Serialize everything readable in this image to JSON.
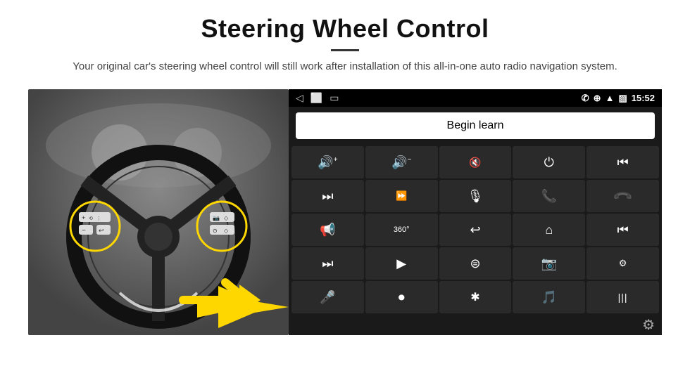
{
  "header": {
    "title": "Steering Wheel Control",
    "divider": true,
    "subtitle": "Your original car's steering wheel control will still work after installation of this all-in-one auto radio navigation system."
  },
  "status_bar": {
    "nav_back": "◁",
    "nav_home": "⬜",
    "nav_recent": "▭",
    "signal": "▨",
    "phone": "✆",
    "location": "⊕",
    "wifi": "▲",
    "time": "15:52"
  },
  "begin_learn": {
    "label": "Begin learn"
  },
  "controls": [
    {
      "icon": "🔊+",
      "name": "vol-up"
    },
    {
      "icon": "🔊−",
      "name": "vol-down"
    },
    {
      "icon": "🔇",
      "name": "mute"
    },
    {
      "icon": "⏻",
      "name": "power"
    },
    {
      "icon": "⏮",
      "name": "prev-track"
    },
    {
      "icon": "⏭",
      "name": "next-track"
    },
    {
      "icon": "⏩",
      "name": "fast-forward"
    },
    {
      "icon": "🎤",
      "name": "mic"
    },
    {
      "icon": "📞",
      "name": "call"
    },
    {
      "icon": "↩",
      "name": "hang-up"
    },
    {
      "icon": "📢",
      "name": "speaker"
    },
    {
      "icon": "360°",
      "name": "360-view"
    },
    {
      "icon": "↩",
      "name": "back"
    },
    {
      "icon": "🏠",
      "name": "home"
    },
    {
      "icon": "⏮⏮",
      "name": "rewind"
    },
    {
      "icon": "⏭⏭",
      "name": "skip-fwd"
    },
    {
      "icon": "▶",
      "name": "nav"
    },
    {
      "icon": "⊜",
      "name": "source"
    },
    {
      "icon": "📷",
      "name": "camera"
    },
    {
      "icon": "⚙",
      "name": "eq"
    },
    {
      "icon": "🎤",
      "name": "mic2"
    },
    {
      "icon": "⏺",
      "name": "circle"
    },
    {
      "icon": "✱",
      "name": "bluetooth"
    },
    {
      "icon": "🎵",
      "name": "music"
    },
    {
      "icon": "|||",
      "name": "spectrum"
    }
  ],
  "settings": {
    "gear_icon": "⚙"
  }
}
